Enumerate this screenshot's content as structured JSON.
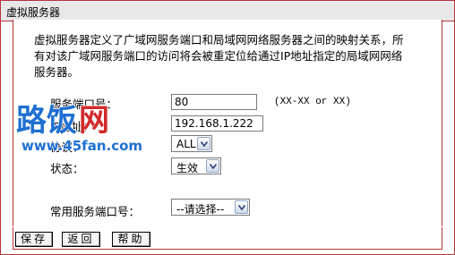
{
  "window": {
    "title": "虚拟服务器"
  },
  "description": "虚拟服务器定义了广域网服务端口和局域网网络服务器之间的映射关系，所有对该广域网服务端口的访问将会被重定位给通过IP地址指定的局域网网络服务器。",
  "form": {
    "port_label": "服务端口号：",
    "port_value": "80",
    "port_hint": "(XX-XX or XX)",
    "ip_label": "IP地址：",
    "ip_value": "192.168.1.222",
    "protocol_label": "协议：",
    "protocol_value": "ALL",
    "status_label": "状态：",
    "status_value": "生效",
    "common_port_label": "常用服务端口号：",
    "common_port_value": "--请选择--"
  },
  "buttons": {
    "save": "保存",
    "back": "返回",
    "help": "帮助"
  },
  "watermark": {
    "main": "路饭网",
    "url": "www.45fan.com"
  },
  "colors": {
    "border": "#b8343a",
    "logo_blue": "#1f6fd1",
    "logo_red": "#d22a2a"
  }
}
